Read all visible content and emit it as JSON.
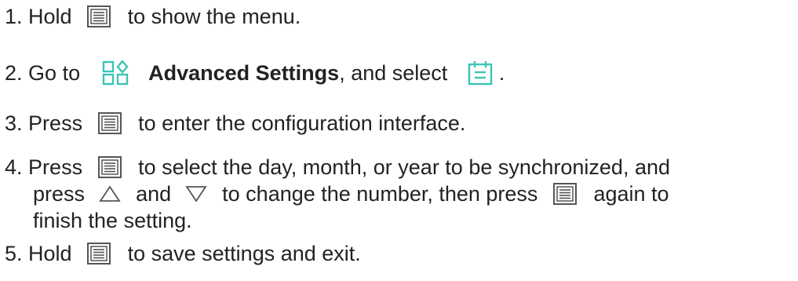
{
  "colors": {
    "text": "#222222",
    "icon_gray": "#555555",
    "accent_teal": "#3cc4b4"
  },
  "icons": {
    "menu": "menu-button-icon",
    "advanced": "advanced-settings-icon",
    "calendar": "date-settings-icon",
    "up": "up-triangle-icon",
    "down": "down-triangle-icon"
  },
  "steps": [
    {
      "number": "1.",
      "t1": "Hold",
      "t2": "to show the menu."
    },
    {
      "number": "2.",
      "t1": "Go to",
      "bold": "Advanced Settings",
      "t2": ", and select",
      "t3": "."
    },
    {
      "number": "3.",
      "t1": "Press",
      "t2": "to enter the configuration interface."
    },
    {
      "number": "4.",
      "t1": "Press",
      "t2": "to select the day, month, or year to be synchronized, and",
      "t3": "press",
      "t4": "and",
      "t5": "to change the number, then press",
      "t6": "again to",
      "t7": "finish the setting."
    },
    {
      "number": "5.",
      "t1": "Hold",
      "t2": "to save settings and exit."
    }
  ]
}
